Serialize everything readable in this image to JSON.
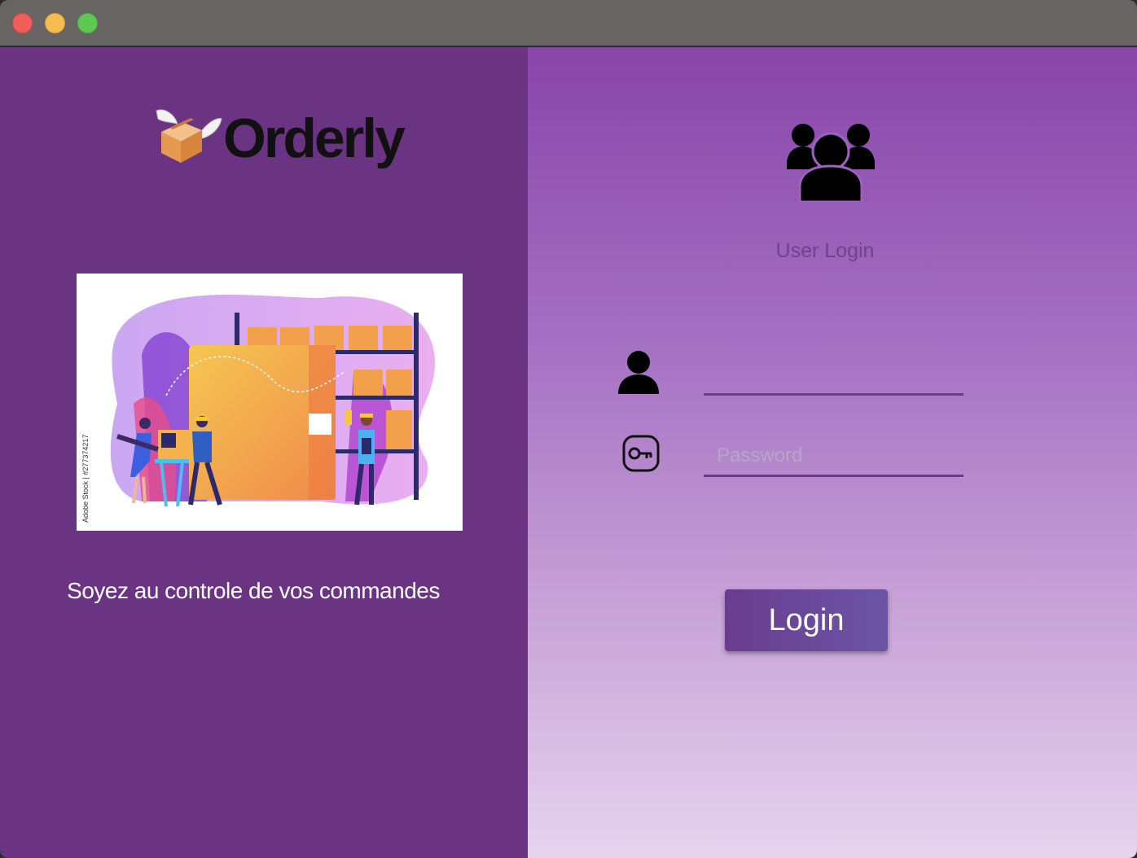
{
  "window": {
    "controls": [
      "close",
      "minimize",
      "zoom"
    ]
  },
  "brand": {
    "name": "Orderly",
    "logo_icon": "winged-box-icon"
  },
  "hero": {
    "image_description_icon": "warehouse-illustration",
    "watermark": "Adobe Stock | #277374217"
  },
  "tagline": "Soyez au controle de vos commandes",
  "login": {
    "header_icon": "users-group-icon",
    "title": "User Login",
    "username": {
      "icon": "user-icon",
      "value": "",
      "placeholder": ""
    },
    "password": {
      "icon": "key-icon",
      "value": "",
      "placeholder": "Password"
    },
    "submit_label": "Login"
  },
  "colors": {
    "left_panel": "#6b3482",
    "right_gradient_top": "#8845a8",
    "right_gradient_bottom": "#e6d4ee",
    "button": "#6a3c8f",
    "field_underline": "#6b3a8a"
  }
}
